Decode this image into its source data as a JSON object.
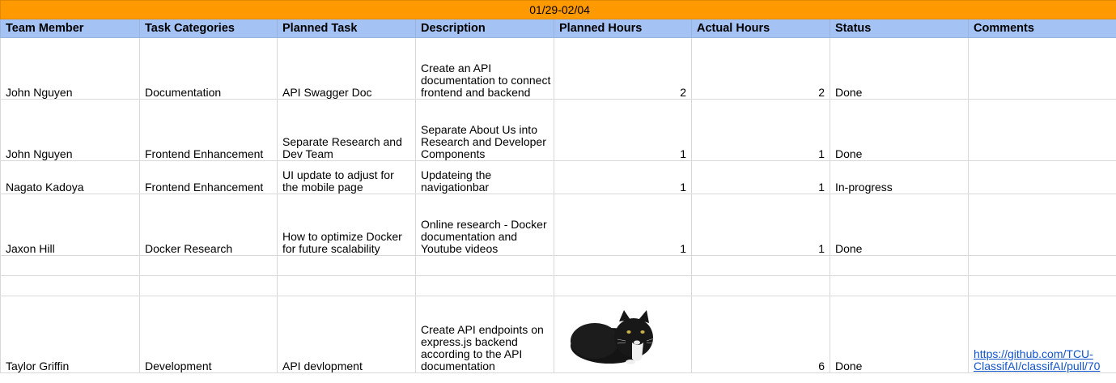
{
  "week_range": "01/29-02/04",
  "columns": [
    "Team Member",
    "Task Categories",
    "Planned Task",
    "Description",
    "Planned Hours",
    "Actual Hours",
    "Status",
    "Comments"
  ],
  "rows": [
    {
      "member": "John Nguyen",
      "category": "Documentation",
      "task": "API Swagger Doc",
      "description": "Create an API documentation to connect frontend and backend",
      "planned": "2",
      "actual": "2",
      "status": "Done",
      "comments": ""
    },
    {
      "member": "John Nguyen",
      "category": "Frontend Enhancement",
      "task": "Separate Research and Dev Team",
      "description": "Separate About Us into Research and Developer Components",
      "planned": "1",
      "actual": "1",
      "status": "Done",
      "comments": ""
    },
    {
      "member": "Nagato Kadoya",
      "category": "Frontend Enhancement",
      "task": "UI update to adjust for the mobile page",
      "description": "Updateing the navigationbar",
      "planned": "1",
      "actual": "1",
      "status": "In-progress",
      "comments": ""
    },
    {
      "member": "Jaxon Hill",
      "category": "Docker Research",
      "task": "How to optimize Docker for future scalability",
      "description": "Online research - Docker documentation and Youtube videos",
      "planned": "1",
      "actual": "1",
      "status": "Done",
      "comments": ""
    },
    {
      "member": "",
      "category": "",
      "task": "",
      "description": "",
      "planned": "",
      "actual": "",
      "status": "",
      "comments": ""
    },
    {
      "member": "",
      "category": "",
      "task": "",
      "description": "",
      "planned": "",
      "actual": "",
      "status": "",
      "comments": ""
    },
    {
      "member": "Taylor Griffin",
      "category": "Development",
      "task": "API devlopment",
      "description": "Create API endpoints on express.js backend according to the API documentation",
      "planned": "",
      "actual": "6",
      "status": "Done",
      "comments": "https://github.com/TCU-ClassifAI/classifAI/pull/70"
    }
  ],
  "image": {
    "name": "black-and-white-cat-photo"
  },
  "colors": {
    "banner": "#ff9900",
    "header": "#a4c2f4",
    "link": "#1155cc"
  }
}
